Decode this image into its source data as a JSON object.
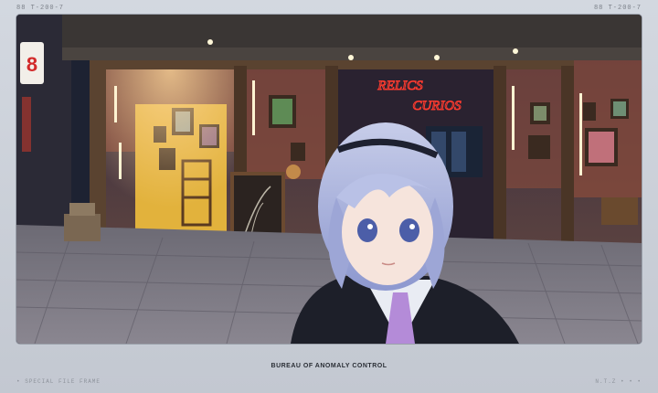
{
  "header": {
    "left_code": "88  T-200-7",
    "right_code": "88  T-200-7"
  },
  "scene": {
    "neon_sign_top": "RELICS",
    "neon_sign_bottom": "CURIOS",
    "street_sign_digit": "8"
  },
  "caption": "BUREAU OF ANOMALY CONTROL",
  "footer": {
    "left_label": "• SPECIAL FILE FRAME",
    "right_label": "N.T.Z • • •"
  }
}
